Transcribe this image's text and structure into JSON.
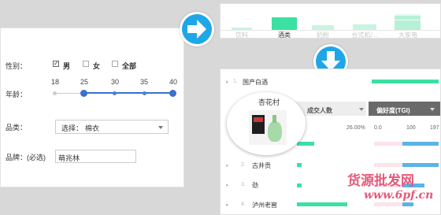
{
  "filter": {
    "gender_label": "性别：",
    "gender_options": [
      {
        "label": "男",
        "checked": true
      },
      {
        "label": "女",
        "checked": false
      },
      {
        "label": "全部",
        "checked": false
      }
    ],
    "age_label": "年龄：",
    "age_ticks": [
      "18",
      "25",
      "30",
      "35",
      "40"
    ],
    "category_label": "品类：",
    "category_select_prefix": "选择：",
    "category_select_value": "棉衣",
    "brand_label": "品牌：(必选)",
    "brand_value": "萌兆林"
  },
  "top_chart": {
    "categories": [
      "饮料",
      "酒类",
      "奶粉",
      "台式机/...",
      "大家电"
    ],
    "selected_category": "酒类",
    "accent": "#3de0a3"
  },
  "table": {
    "first_row": {
      "rank": "1.",
      "name": "国产白酒"
    },
    "headers": {
      "count": "成交人数",
      "tgi": "偏好度(TGI)"
    },
    "scale": {
      "percent": "26.00%",
      "tgi_min": "0.0",
      "tgi_mid": "100",
      "tgi_max": "197"
    },
    "magnifier_title": "杏花村",
    "rows": [
      {
        "rank": "2.",
        "name": "古井贡"
      },
      {
        "rank": "3.",
        "name": "劲"
      },
      {
        "rank": "4.",
        "name": "泸州老窖"
      }
    ],
    "bar_color": "#3de0a3",
    "tgi_color": "#5ab4e8"
  },
  "watermark": {
    "line1": "货源批发网",
    "line2": "www.6pf.cn"
  }
}
